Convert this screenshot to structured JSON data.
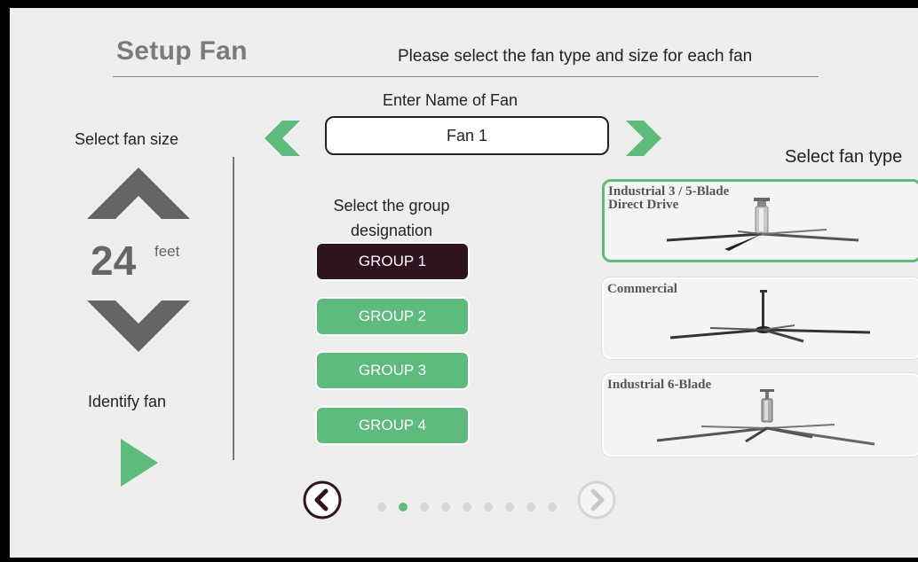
{
  "header": {
    "title": "Setup Fan",
    "subtitle": "Please select the fan type and size for each fan"
  },
  "fan_name": {
    "label": "Enter Name of Fan",
    "value": "Fan 1",
    "prev_icon": "chevron-left-icon",
    "next_icon": "chevron-right-icon"
  },
  "fan_size": {
    "label": "Select fan size",
    "value": "24",
    "unit": "feet",
    "up_icon": "chevron-up-icon",
    "down_icon": "chevron-down-icon"
  },
  "identify": {
    "label": "Identify fan",
    "icon": "play-icon"
  },
  "groups": {
    "label": "Select the group designation",
    "selected": "GROUP 1",
    "items": [
      {
        "label": "GROUP 1",
        "selected": true
      },
      {
        "label": "GROUP 2",
        "selected": false
      },
      {
        "label": "GROUP 3",
        "selected": false
      },
      {
        "label": "GROUP 4",
        "selected": false
      }
    ]
  },
  "fan_types": {
    "label": "Select fan type",
    "items": [
      {
        "name_line1": "Industrial 3 / 5-Blade",
        "name_line2": "Direct Drive",
        "selected": true
      },
      {
        "name_line1": "Commercial",
        "selected": false
      },
      {
        "name_line1": "Industrial 6-Blade",
        "selected": false
      }
    ]
  },
  "pagination": {
    "current_page": 2,
    "total_pages": 9,
    "prev_icon": "circle-chevron-left-icon",
    "next_icon": "circle-chevron-right-icon"
  },
  "colors": {
    "accent_green": "#5dbb7c",
    "selected_group": "#2f1420",
    "arrow_gray": "#646464",
    "background": "#eeeeee"
  }
}
